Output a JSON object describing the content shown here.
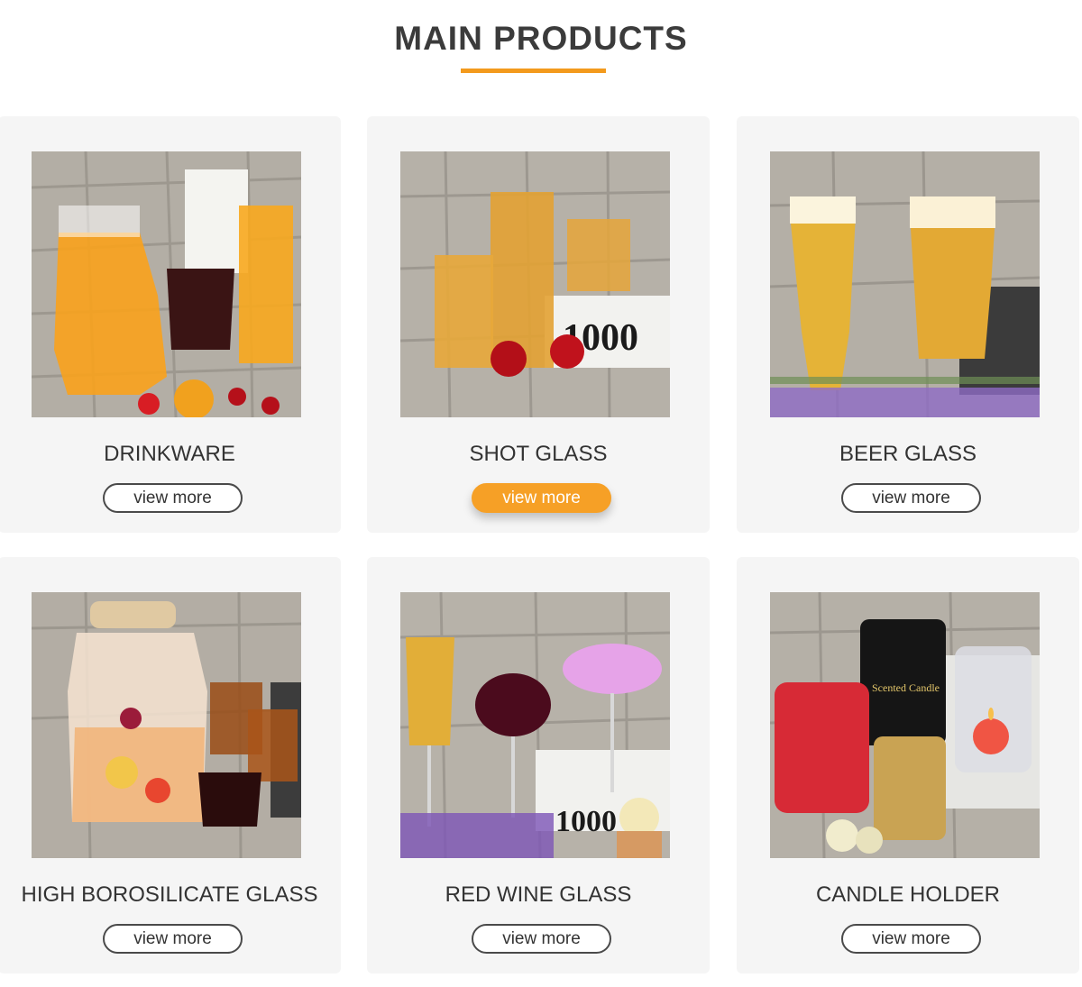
{
  "section": {
    "title": "MAIN PRODUCTS",
    "accent_color": "#f39a1d"
  },
  "products": [
    {
      "name": "DRINKWARE",
      "button": "view more",
      "active": false
    },
    {
      "name": "SHOT GLASS",
      "button": "view more",
      "active": true
    },
    {
      "name": "BEER GLASS",
      "button": "view more",
      "active": false
    },
    {
      "name": "HIGH BOROSILICATE GLASS",
      "button": "view more",
      "active": false
    },
    {
      "name": "RED WINE GLASS",
      "button": "view more",
      "active": false
    },
    {
      "name": "CANDLE HOLDER",
      "button": "view more",
      "active": false
    }
  ],
  "photo_book": {
    "number": "1000"
  },
  "photo_candle_label": {
    "text": "Scented Candle"
  }
}
